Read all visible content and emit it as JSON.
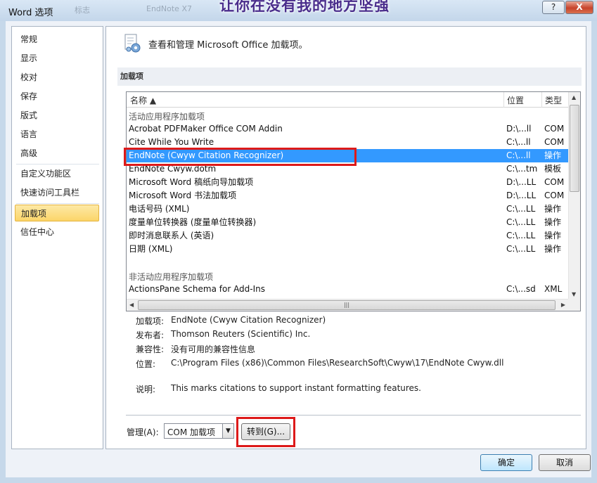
{
  "window": {
    "title": "Word 选项",
    "faded_title_items": [
      "标志",
      "EndNote X7"
    ],
    "watermark": "让你在没有我的地方坚强",
    "help": "?",
    "close": "X"
  },
  "nav": {
    "items": [
      "常规",
      "显示",
      "校对",
      "保存",
      "版式",
      "语言",
      "高级",
      "自定义功能区",
      "快速访问工具栏",
      "加载项",
      "信任中心"
    ],
    "active": "加载项"
  },
  "header": {
    "text": "查看和管理 Microsoft Office 加载项。",
    "icon": "gear-sheet-icon"
  },
  "section": {
    "title": "加载项"
  },
  "list": {
    "columns": {
      "name": "名称 ▲",
      "location": "位置",
      "type": "类型"
    },
    "active_group": "活动应用程序加载项",
    "active_rows": [
      {
        "name": "Acrobat PDFMaker Office COM Addin",
        "location": "D:\\...ll",
        "type": "COM"
      },
      {
        "name": "Cite While You Write",
        "location": "C:\\...ll",
        "type": "COM"
      },
      {
        "name": "EndNote (Cwyw Citation Recognizer)",
        "location": "C:\\...ll",
        "type": "操作"
      },
      {
        "name": "EndNote Cwyw.dotm",
        "location": "C:\\...tm",
        "type": "模板"
      },
      {
        "name": "Microsoft Word 稿纸向导加载项",
        "location": "D:\\...LL",
        "type": "COM"
      },
      {
        "name": "Microsoft Word 书法加载项",
        "location": "D:\\...LL",
        "type": "COM"
      },
      {
        "name": "电话号码 (XML)",
        "location": "C:\\...LL",
        "type": "操作"
      },
      {
        "name": "度量单位转换器 (度量单位转换器)",
        "location": "C:\\...LL",
        "type": "操作"
      },
      {
        "name": "即时消息联系人 (英语)",
        "location": "C:\\...LL",
        "type": "操作"
      },
      {
        "name": "日期 (XML)",
        "location": "C:\\...LL",
        "type": "操作"
      }
    ],
    "selected": "EndNote (Cwyw Citation Recognizer)",
    "inactive_group": "非活动应用程序加载项",
    "inactive_rows": [
      {
        "name": "ActionsPane Schema for Add-Ins",
        "location": "C:\\...sd",
        "type": "XML ..."
      }
    ]
  },
  "details": {
    "addin_label": "加载项:",
    "addin": "EndNote (Cwyw Citation Recognizer)",
    "publisher_label": "发布者:",
    "publisher": "Thomson Reuters (Scientific) Inc.",
    "compat_label": "兼容性:",
    "compat": "没有可用的兼容性信息",
    "location_label": "位置:",
    "location": "C:\\Program Files (x86)\\Common Files\\ResearchSoft\\Cwyw\\17\\EndNote Cwyw.dll",
    "desc_label": "说明:",
    "desc": "This marks citations to support instant formatting features."
  },
  "manage": {
    "label": "管理(A):",
    "value": "COM 加载项",
    "go": "转到(G)..."
  },
  "buttons": {
    "ok": "确定",
    "cancel": "取消"
  },
  "colors": {
    "selection": "#3399ff",
    "highlight_border": "#dd1a1a",
    "nav_active": "#fbd569"
  }
}
